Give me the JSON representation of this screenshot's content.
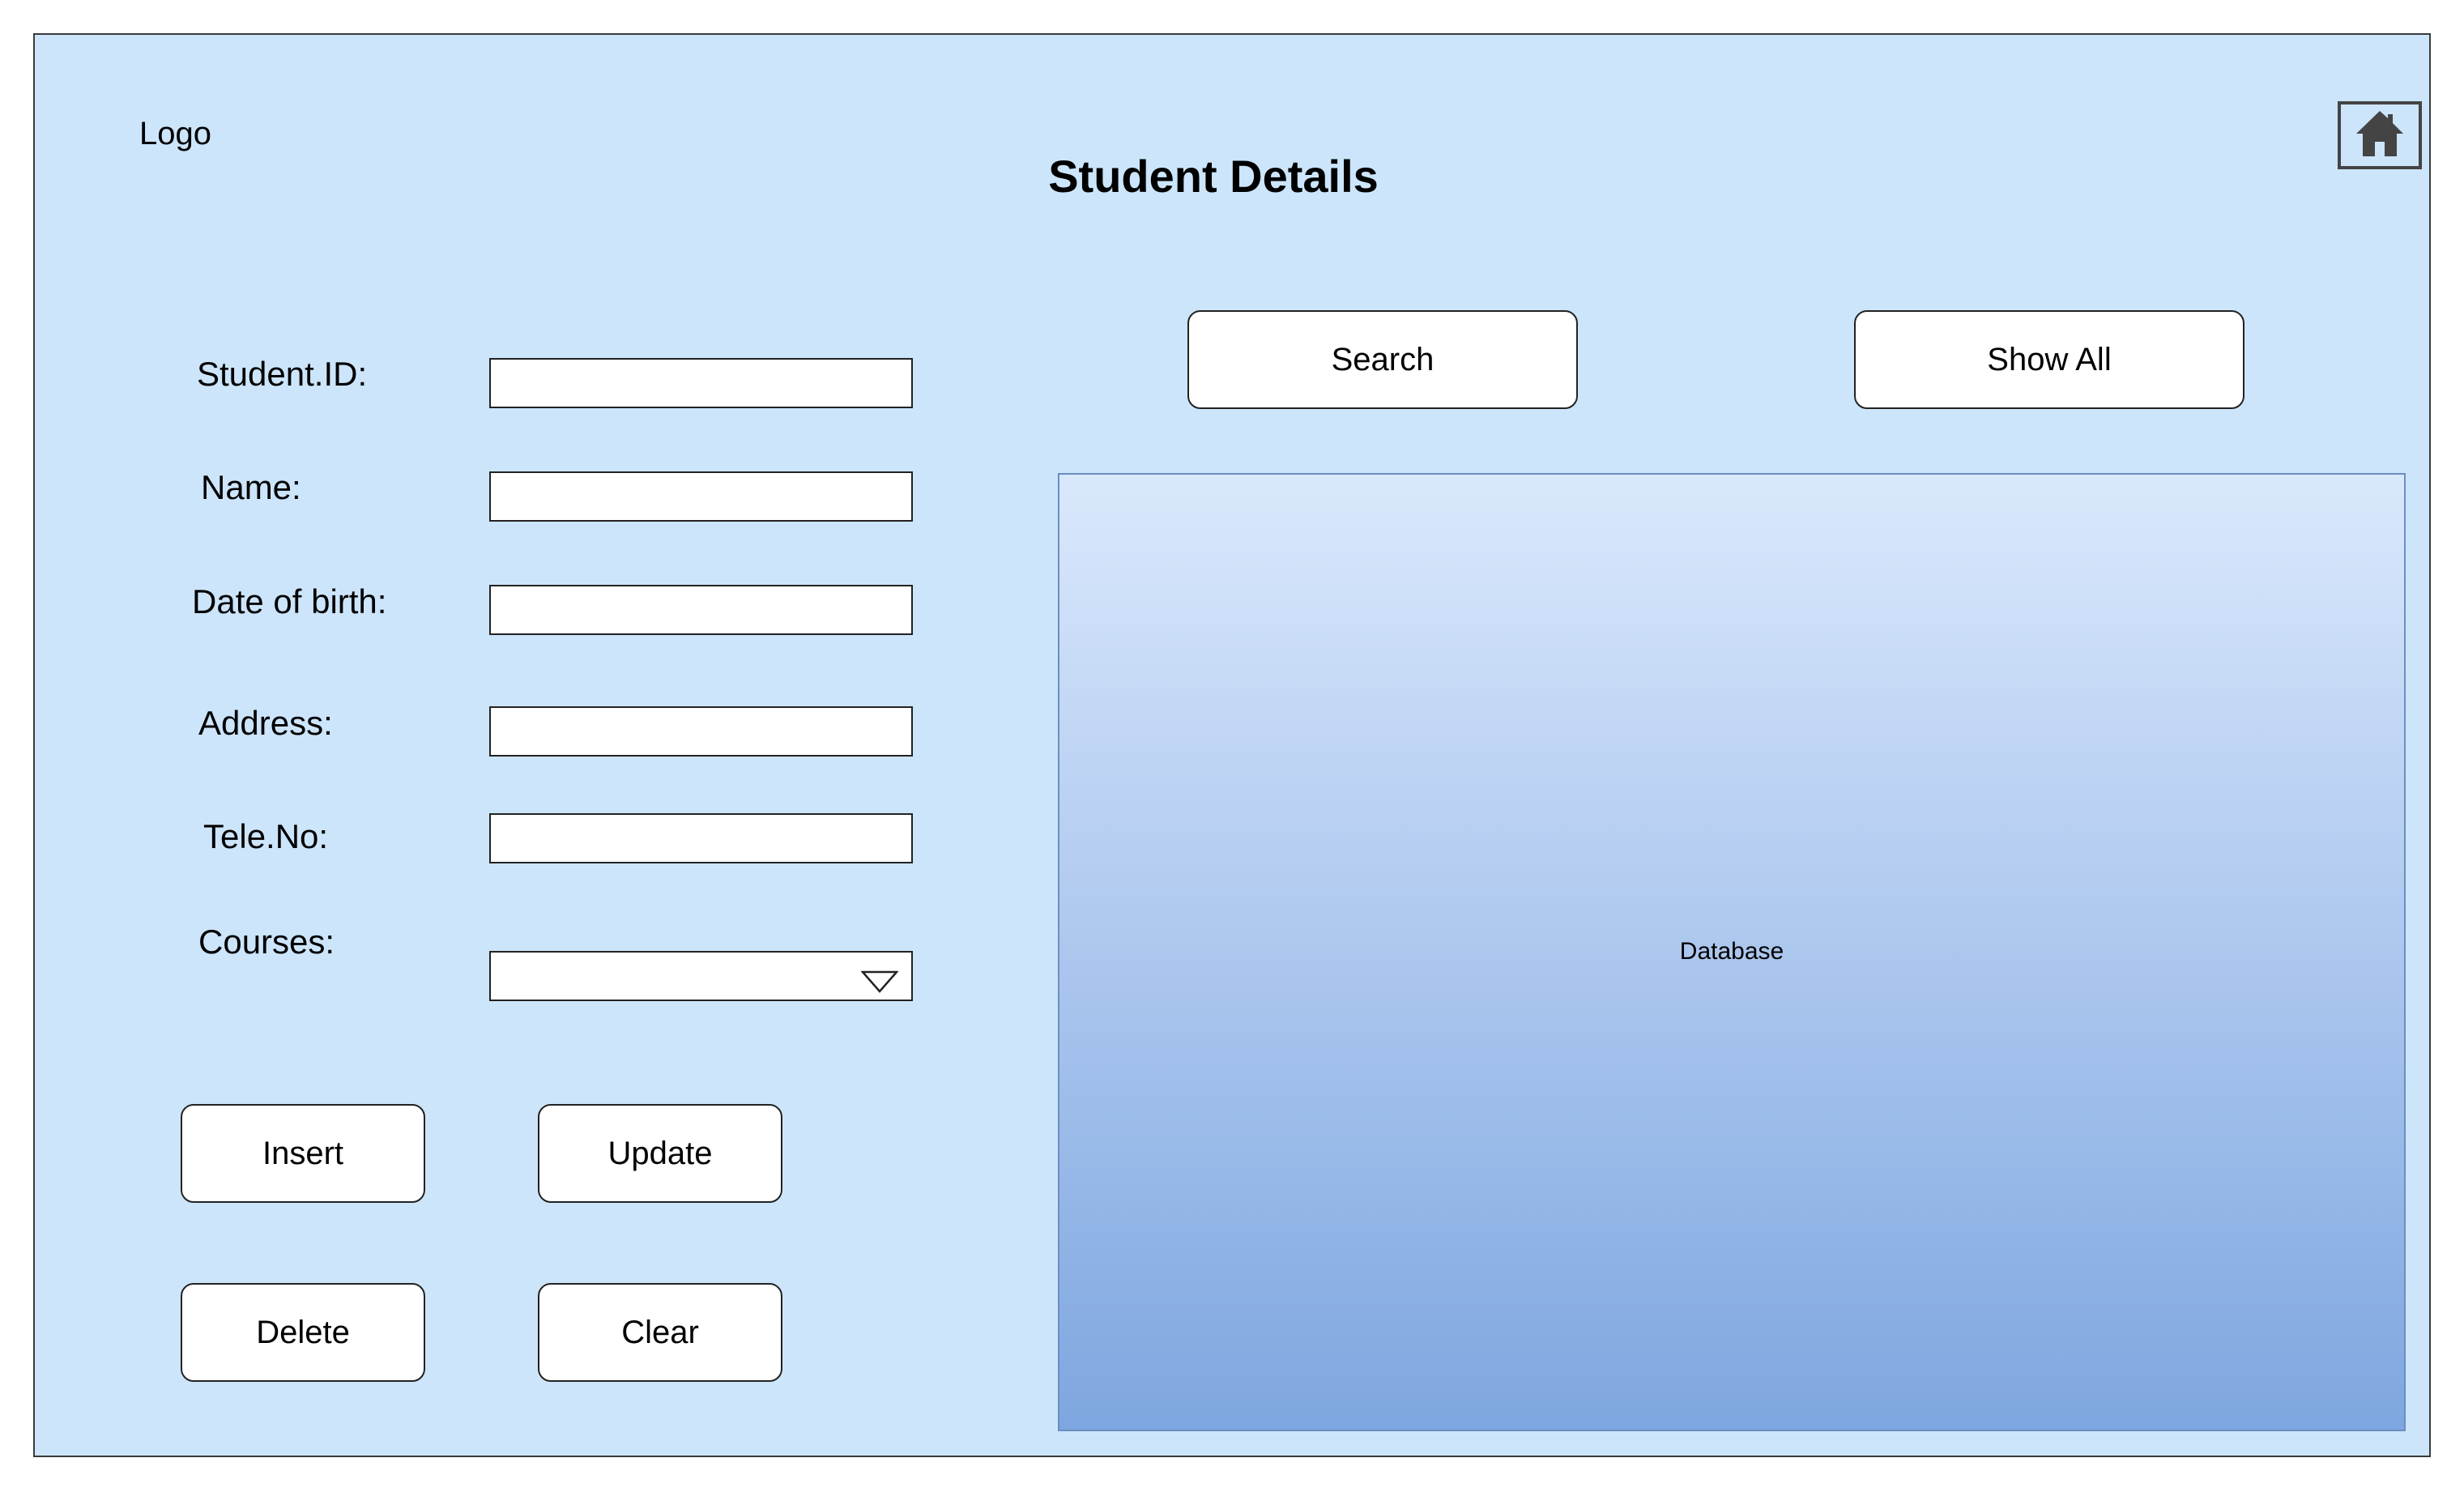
{
  "header": {
    "logo": "Logo",
    "title": "Student Details"
  },
  "form": {
    "student_id": {
      "label": "Student.ID:",
      "value": ""
    },
    "name": {
      "label": "Name:",
      "value": ""
    },
    "dob": {
      "label": "Date of birth:",
      "value": ""
    },
    "address": {
      "label": "Address:",
      "value": ""
    },
    "tele": {
      "label": "Tele.No:",
      "value": ""
    },
    "courses": {
      "label": "Courses:",
      "value": ""
    }
  },
  "actions": {
    "insert": "Insert",
    "update": "Update",
    "delete": "Delete",
    "clear": "Clear"
  },
  "search": {
    "search": "Search",
    "show_all": "Show All"
  },
  "database": {
    "label": "Database"
  },
  "icons": {
    "home": "home-icon",
    "dropdown": "chevron-down-icon"
  },
  "colors": {
    "background": "#cce5fb",
    "db_gradient_top": "#dae8fc",
    "db_gradient_bottom": "#7ea6e0",
    "db_border": "#6c8ebf"
  }
}
